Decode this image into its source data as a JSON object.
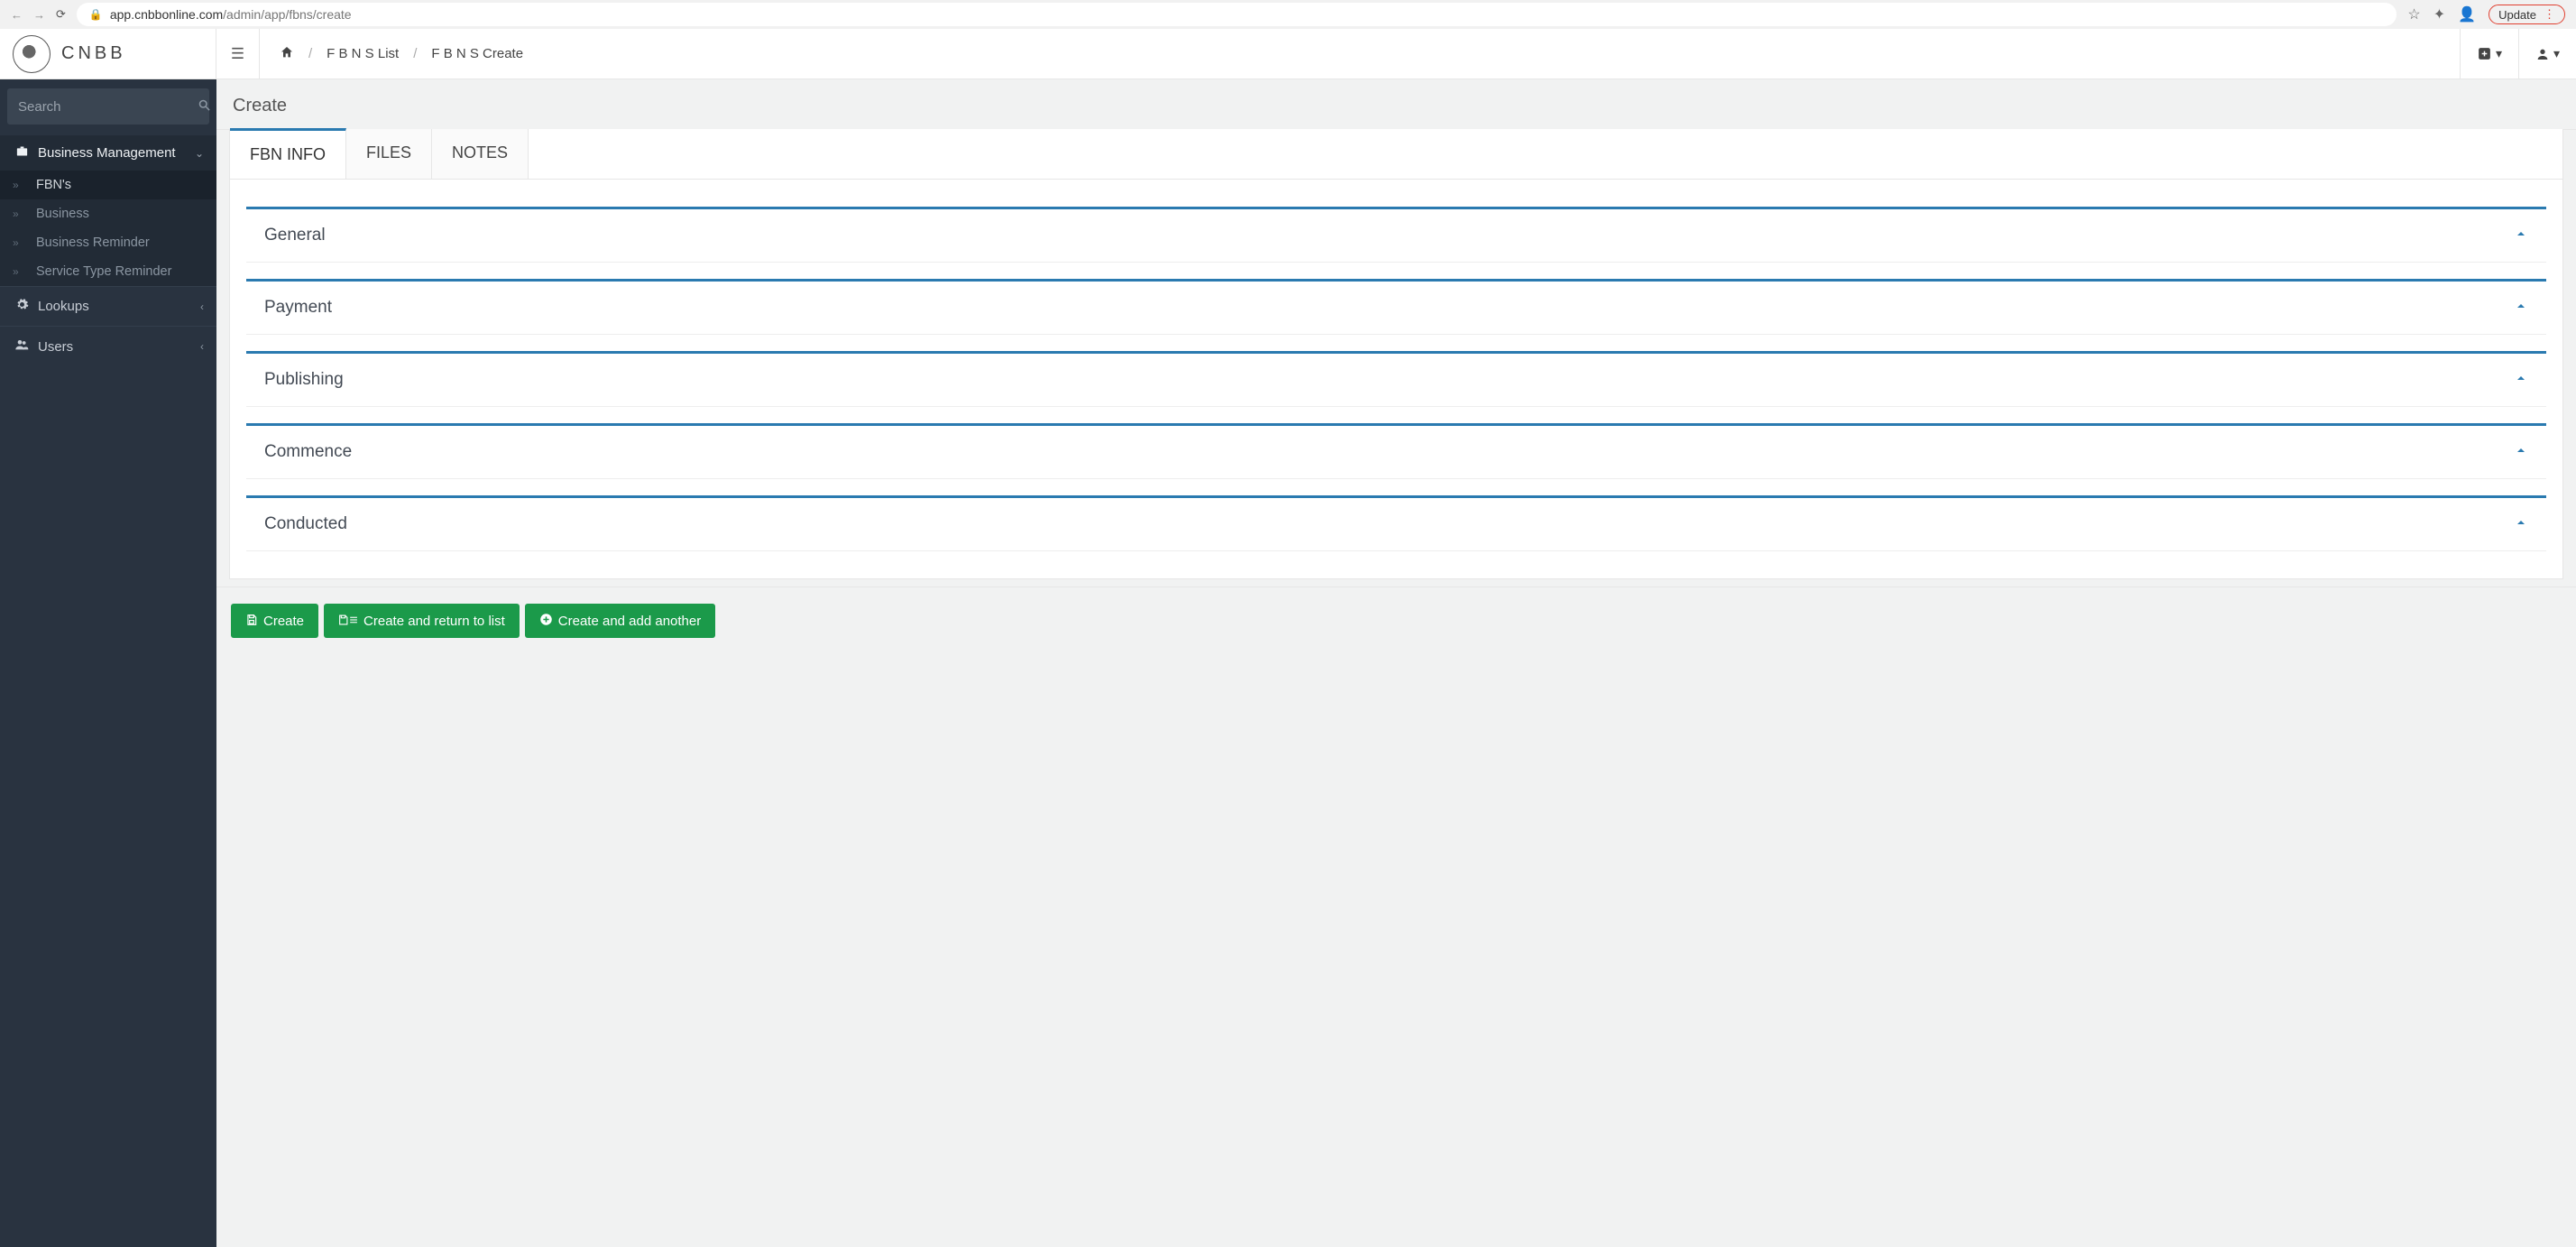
{
  "browser": {
    "url_host": "app.cnbbonline.com",
    "url_path": "/admin/app/fbns/create",
    "update_label": "Update"
  },
  "header": {
    "logo_text": "CNBB",
    "breadcrumb": {
      "list_label": "F B N S List",
      "create_label": "F B N S Create"
    }
  },
  "sidebar": {
    "search_placeholder": "Search",
    "sections": {
      "business_management": {
        "label": "Business Management",
        "items": [
          "FBN's",
          "Business",
          "Business Reminder",
          "Service Type Reminder"
        ]
      },
      "lookups": {
        "label": "Lookups"
      },
      "users": {
        "label": "Users"
      }
    }
  },
  "page": {
    "title": "Create",
    "tabs": [
      "FBN INFO",
      "FILES",
      "NOTES"
    ],
    "accordions": [
      "General",
      "Payment",
      "Publishing",
      "Commence",
      "Conducted"
    ],
    "buttons": {
      "create": "Create",
      "create_return": "Create and return to list",
      "create_another": "Create and add another"
    }
  }
}
